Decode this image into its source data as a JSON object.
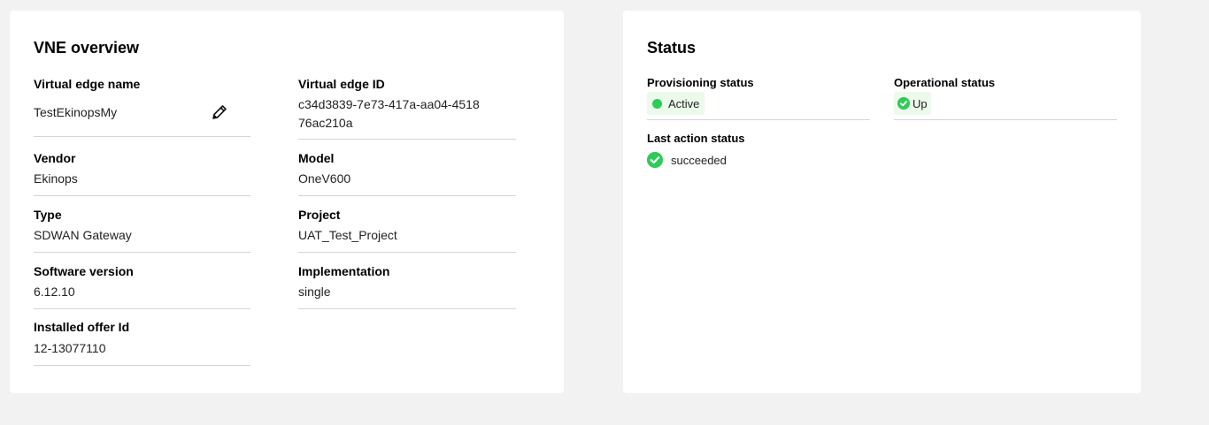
{
  "overview": {
    "title": "VNE overview",
    "virtual_edge_name": {
      "label": "Virtual edge name",
      "value": "TestEkinopsMy"
    },
    "virtual_edge_id": {
      "label": "Virtual edge ID",
      "value": "c34d3839-7e73-417a-aa04-451876ac210a"
    },
    "vendor": {
      "label": "Vendor",
      "value": "Ekinops"
    },
    "model": {
      "label": "Model",
      "value": "OneV600"
    },
    "type": {
      "label": "Type",
      "value": "SDWAN Gateway"
    },
    "project": {
      "label": "Project",
      "value": "UAT_Test_Project"
    },
    "software_version": {
      "label": "Software version",
      "value": "6.12.10"
    },
    "implementation": {
      "label": "Implementation",
      "value": "single"
    },
    "installed_offer_id": {
      "label": "Installed offer Id",
      "value": "12-13077110"
    },
    "edit_icon": "pencil-icon"
  },
  "status": {
    "title": "Status",
    "provisioning": {
      "label": "Provisioning status",
      "value": "Active",
      "icon": "status-dot"
    },
    "operational": {
      "label": "Operational status",
      "value": "Up",
      "icon": "check-circle-icon"
    },
    "last_action": {
      "label": "Last action status",
      "value": "succeeded",
      "icon": "check-circle-icon"
    },
    "colors": {
      "success": "#2ecc57",
      "pill_bg": "#ecfaeb"
    }
  }
}
